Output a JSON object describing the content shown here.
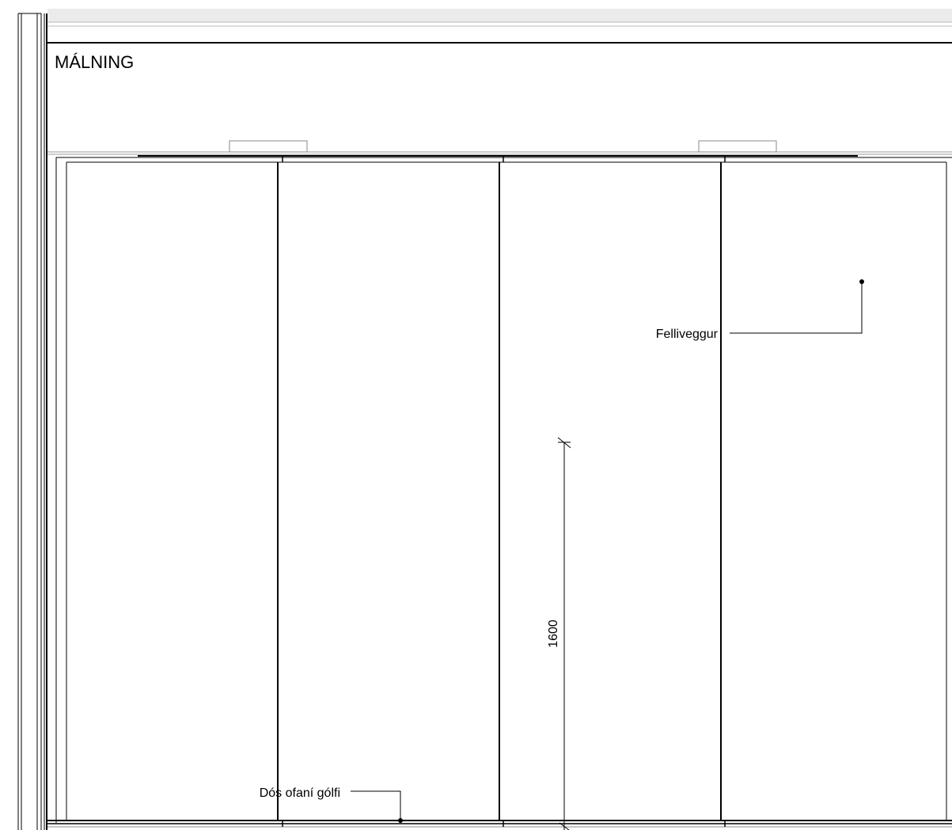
{
  "drawing": {
    "section_title": "MÁLNING",
    "labels": {
      "partition_wall": "Felliveggur",
      "floor_drain": "Dós ofaní gólfi"
    },
    "dimension": {
      "value": "1600"
    }
  },
  "colors": {
    "line": "#000000",
    "thin_line": "#888888",
    "header_band": "#ebebeb",
    "background": "#ffffff"
  }
}
